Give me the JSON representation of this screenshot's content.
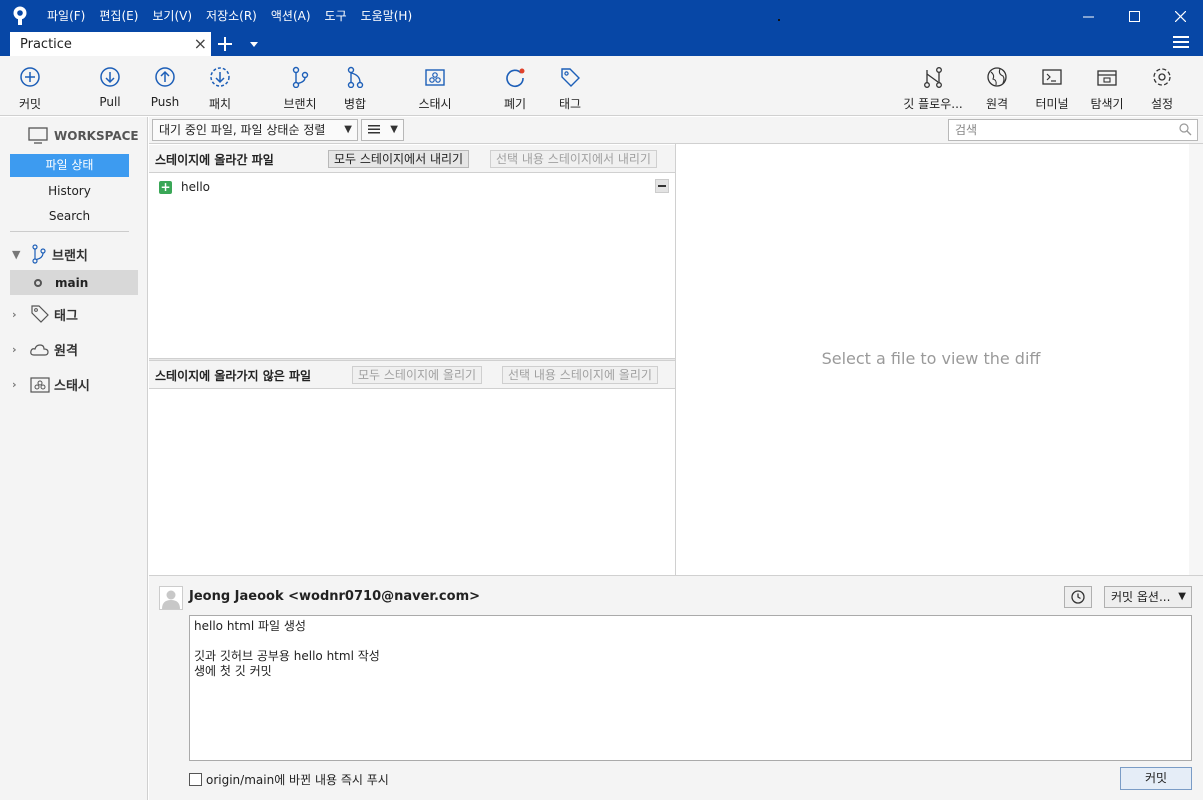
{
  "menu": [
    "파일(F)",
    "편집(E)",
    "보기(V)",
    "저장소(R)",
    "액션(A)",
    "도구",
    "도움말(H)"
  ],
  "tab": {
    "title": "Practice",
    "close": "×"
  },
  "toolbar": {
    "commit": "커밋",
    "pull": "Pull",
    "push": "Push",
    "fetch": "패치",
    "branch": "브랜치",
    "merge": "병합",
    "stash": "스태시",
    "discard": "폐기",
    "tag": "태그",
    "git_flow": "깃 플로우...",
    "remote": "원격",
    "terminal": "터미널",
    "explorer": "탐색기",
    "settings": "설정"
  },
  "sidebar": {
    "workspace_title": "WORKSPACE",
    "workspace_items": [
      "파일 상태",
      "History",
      "Search"
    ],
    "branches_label": "브랜치",
    "branch_current": "main",
    "tags_label": "태그",
    "remotes_label": "원격",
    "stashes_label": "스태시"
  },
  "filter": {
    "mode": "대기 중인 파일, 파일 상태순 정렬",
    "search_placeholder": "검색"
  },
  "staged": {
    "title": "스테이지에 올라간 파일",
    "unstage_all": "모두 스테이지에서 내리기",
    "unstage_selected": "선택 내용 스테이지에서 내리기",
    "files": [
      "hello"
    ]
  },
  "unstaged": {
    "title": "스테이지에 올라가지 않은 파일",
    "stage_all": "모두 스테이지에 올리기",
    "stage_selected": "선택 내용 스테이지에 올리기"
  },
  "diff": {
    "placeholder": "Select a file to view the diff"
  },
  "commit": {
    "author": "Jeong Jaeook <wodnr0710@naver.com>",
    "options": "커밋 옵션...",
    "message": "hello html 파일 생성\n\n깃과 깃허브 공부용 hello html 작성\n생에 첫 깃 커밋",
    "push_checkbox": "origin/main에 바뀐 내용 즉시 푸시",
    "commit_button": "커밋"
  },
  "colors": {
    "titlebar": "#0747a6",
    "accent": "#3d9bf0",
    "icon_blue": "#1d5fb8",
    "add_green": "#3aa757"
  }
}
